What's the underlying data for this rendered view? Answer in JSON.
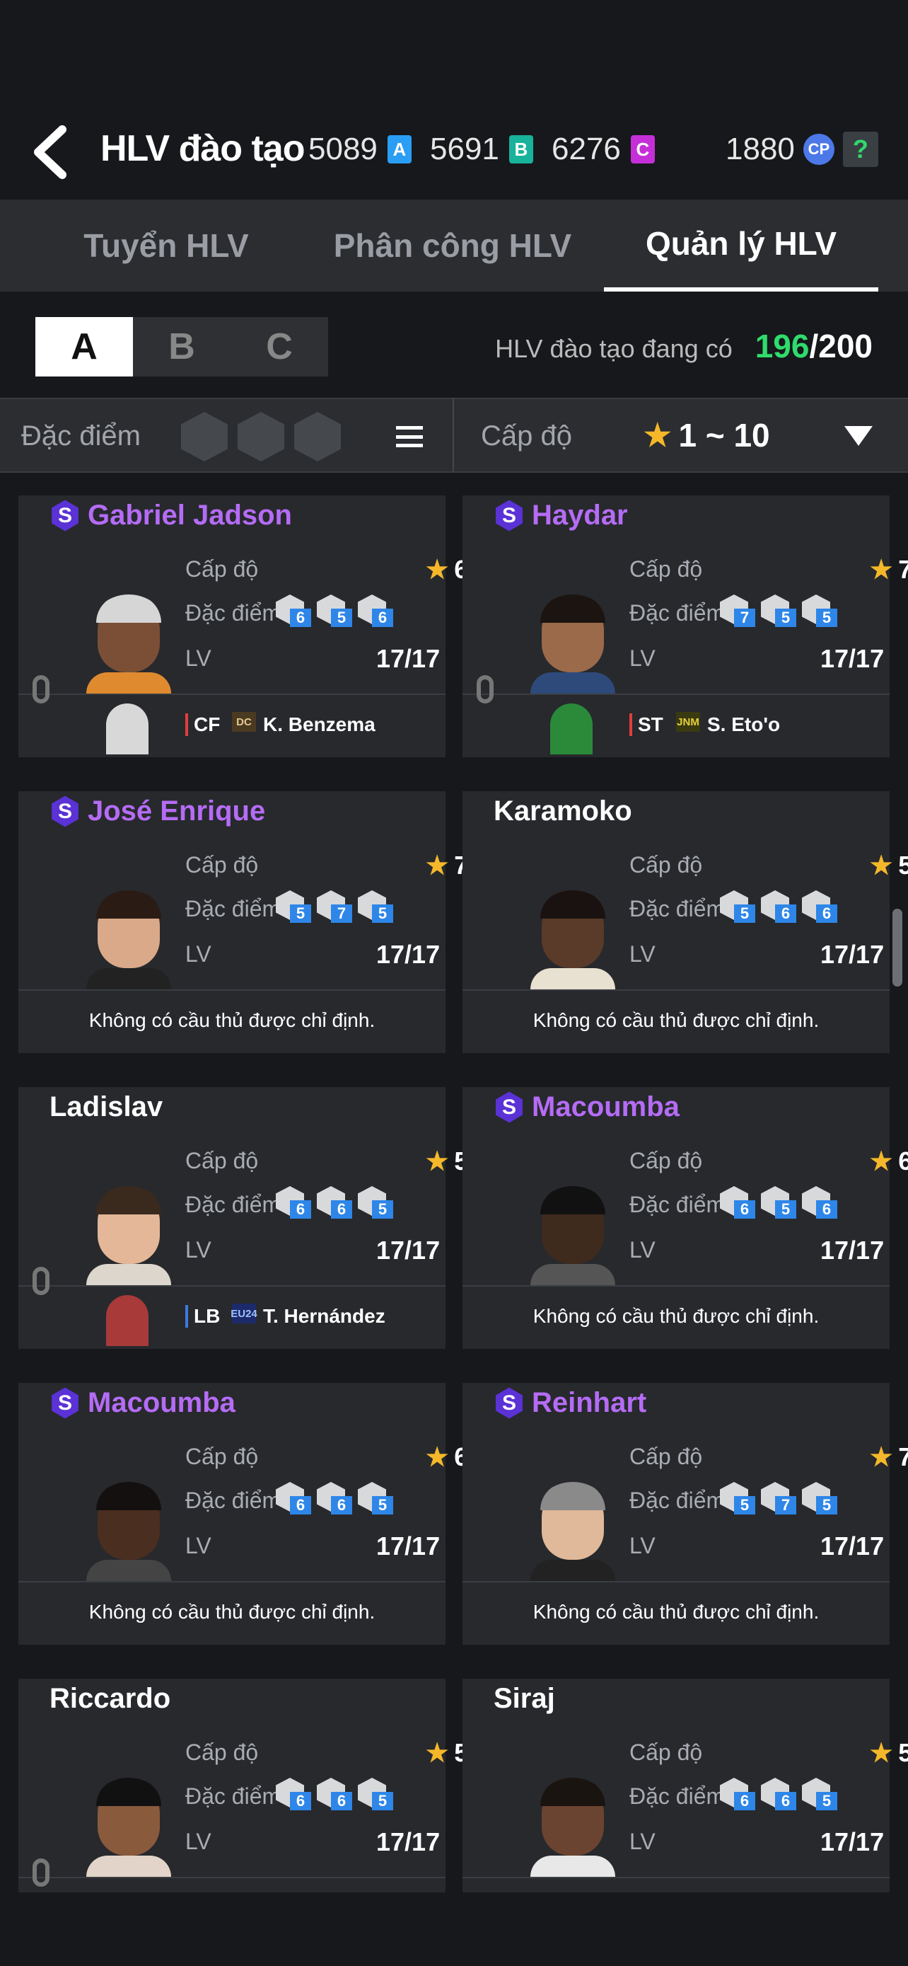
{
  "header": {
    "title": "HLV đào tạo",
    "currencies": [
      {
        "value": "5089",
        "badge": "A",
        "color": "#2a9df4"
      },
      {
        "value": "5691",
        "badge": "B",
        "color": "#18b39a"
      },
      {
        "value": "6276",
        "badge": "C",
        "color": "#c52fd8"
      }
    ],
    "cp_value": "1880",
    "cp_label": "CP",
    "help": "?"
  },
  "tabs": [
    "Tuyển HLV",
    "Phân công HLV",
    "Quản lý HLV"
  ],
  "active_tab": 2,
  "segments": [
    "A",
    "B",
    "C"
  ],
  "active_segment": 0,
  "count": {
    "label": "HLV đào tạo đang có",
    "current": "196",
    "max": "/200"
  },
  "filter": {
    "trait_label": "Đặc điểm c",
    "level_label": "Cấp độ",
    "level_range": "1 ~ 10"
  },
  "labels": {
    "level": "Cấp độ",
    "traits": "Đặc điểm",
    "lv": "LV",
    "none": "Không có cầu thủ được chỉ định."
  },
  "coaches": [
    {
      "name": "Gabriel Jadson",
      "special": true,
      "stars": "6",
      "traits": [
        "6",
        "5",
        "6"
      ],
      "lv": "17/17",
      "assigned": {
        "pos": "CF",
        "tag": "DC",
        "player": "K. Benzema"
      }
    },
    {
      "name": "Haydar",
      "special": true,
      "stars": "7",
      "traits": [
        "7",
        "5",
        "5"
      ],
      "lv": "17/17",
      "assigned": {
        "pos": "ST",
        "tag": "JNM",
        "player": "S. Eto'o"
      }
    },
    {
      "name": "José Enrique",
      "special": true,
      "stars": "7",
      "traits": [
        "5",
        "7",
        "5"
      ],
      "lv": "17/17",
      "assigned": null
    },
    {
      "name": "Karamoko",
      "special": false,
      "stars": "5",
      "traits": [
        "5",
        "6",
        "6"
      ],
      "lv": "17/17",
      "assigned": null
    },
    {
      "name": "Ladislav",
      "special": false,
      "stars": "5",
      "traits": [
        "6",
        "6",
        "5"
      ],
      "lv": "17/17",
      "assigned": {
        "pos": "LB",
        "tag": "EU24",
        "player": "T. Hernández"
      }
    },
    {
      "name": "Macoumba",
      "special": true,
      "stars": "6",
      "traits": [
        "6",
        "5",
        "6"
      ],
      "lv": "17/17",
      "assigned": null
    },
    {
      "name": "Macoumba",
      "special": true,
      "stars": "6",
      "traits": [
        "6",
        "6",
        "5"
      ],
      "lv": "17/17",
      "assigned": null
    },
    {
      "name": "Reinhart",
      "special": true,
      "stars": "7",
      "traits": [
        "5",
        "7",
        "5"
      ],
      "lv": "17/17",
      "assigned": null
    },
    {
      "name": "Riccardo",
      "special": false,
      "stars": "5",
      "traits": [
        "6",
        "6",
        "5"
      ],
      "lv": "17/17",
      "assigned": null
    },
    {
      "name": "Siraj",
      "special": false,
      "stars": "5",
      "traits": [
        "6",
        "6",
        "5"
      ],
      "lv": "17/17",
      "assigned": null
    }
  ],
  "colors": {
    "accent_purple": "#b56cf5",
    "green": "#2fdc6c",
    "star": "#f5b82a",
    "trait_badge": "#2e86e8"
  }
}
